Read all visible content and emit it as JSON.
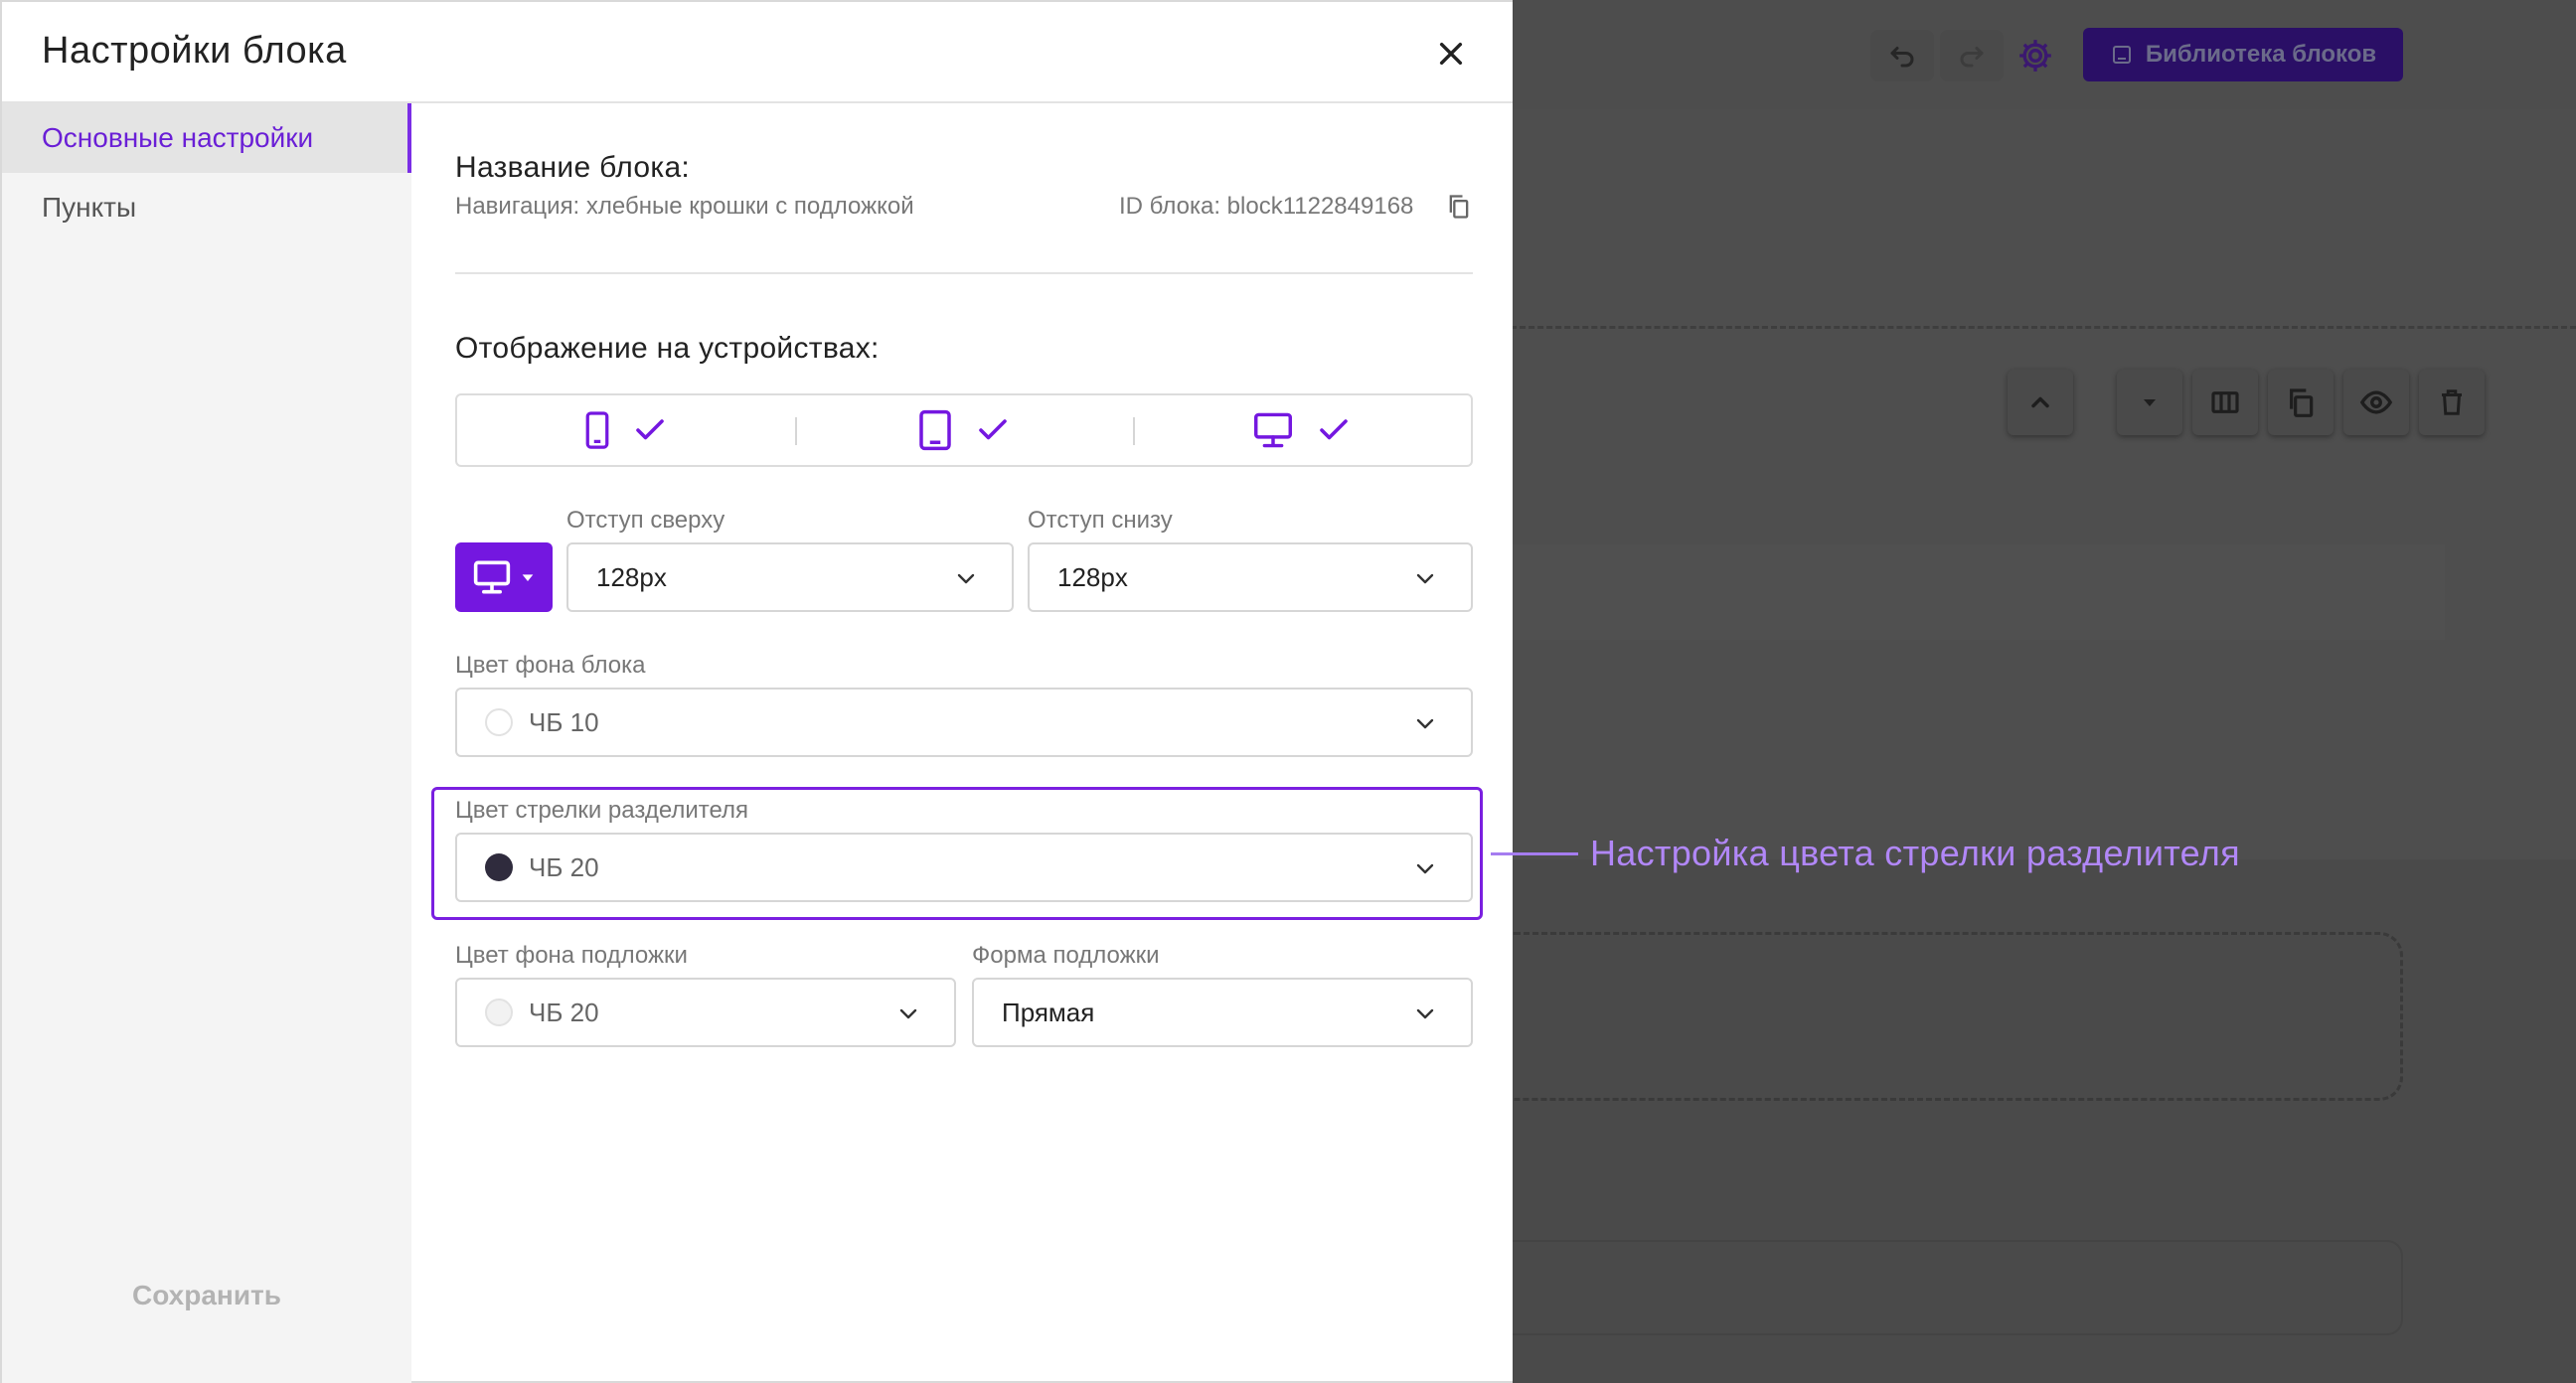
{
  "modal": {
    "title": "Настройки блока",
    "tabs": [
      {
        "label": "Основные настройки",
        "active": true
      },
      {
        "label": "Пункты",
        "active": false
      }
    ],
    "save_label": "Сохранить"
  },
  "block_info": {
    "name_title": "Название блока:",
    "name_value": "Навигация: хлебные крошки с подложкой",
    "id_text": "ID блока: block1122849168"
  },
  "devices": {
    "title": "Отображение на устройствах:",
    "items": [
      {
        "icon": "smartphone-icon",
        "checked": true
      },
      {
        "icon": "tablet-icon",
        "checked": true
      },
      {
        "icon": "desktop-icon",
        "checked": true
      }
    ]
  },
  "padding": {
    "top_label": "Отступ сверху",
    "top_value": "128px",
    "bottom_label": "Отступ снизу",
    "bottom_value": "128px"
  },
  "bg_color": {
    "label": "Цвет фона блока",
    "value": "ЧБ 10",
    "swatch": "#ffffff"
  },
  "arrow_color": {
    "label": "Цвет стрелки разделителя",
    "value": "ЧБ 20",
    "swatch": "#2f2b3d"
  },
  "backing": {
    "color_label": "Цвет фона подложки",
    "color_value": "ЧБ 20",
    "color_swatch": "#f2f2f2",
    "shape_label": "Форма подложки",
    "shape_value": "Прямая"
  },
  "callout": {
    "text": "Настройка цвета стрелки разделителя"
  },
  "editor": {
    "library_button": "Библиотека блоков"
  },
  "colors": {
    "accent": "#7417e0",
    "highlight": "#7a1fe0",
    "callout": "#b187f7"
  }
}
